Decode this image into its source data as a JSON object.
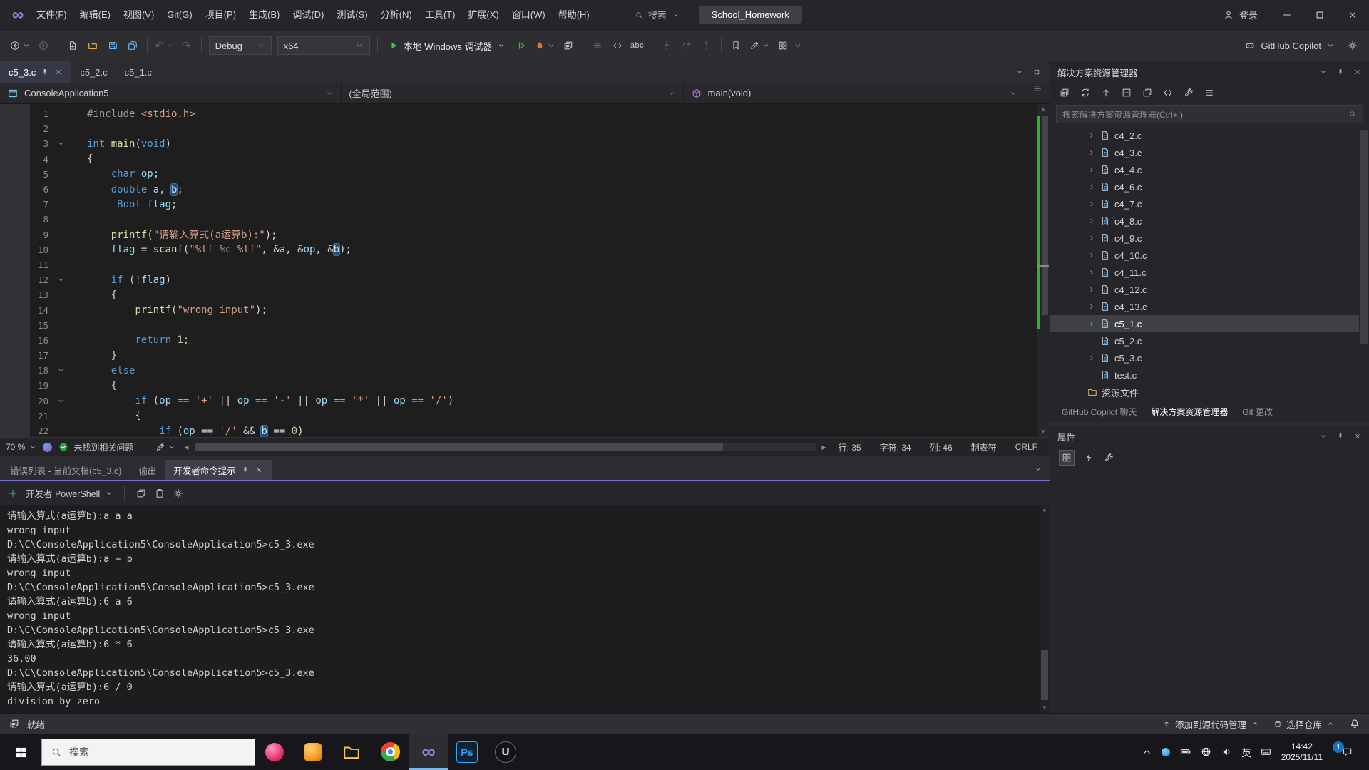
{
  "colors": {
    "accent_purple": "#7a73c9",
    "run_green": "#3fc34f",
    "change_bar_green": "#2db52d",
    "keyword_blue": "#569cd6",
    "string_orange": "#d69d85",
    "local_blue": "#9cdcfe",
    "function_yellow": "#dcdcaa",
    "number_green": "#b5cea8",
    "selection_blue": "#264f78",
    "editor_bg": "#1e1e1e"
  },
  "titlebar": {
    "menus": [
      "文件(F)",
      "编辑(E)",
      "视图(V)",
      "Git(G)",
      "项目(P)",
      "生成(B)",
      "调试(D)",
      "测试(S)",
      "分析(N)",
      "工具(T)",
      "扩展(X)",
      "窗口(W)",
      "帮助(H)"
    ],
    "search_label": "搜索",
    "solution_name": "School_Homework",
    "sign_in_label": "登录"
  },
  "toolbar": {
    "configuration": "Debug",
    "platform": "x64",
    "run_label": "本地 Windows 调试器",
    "spell_label": "abc",
    "copilot_label": "GitHub Copilot"
  },
  "editor": {
    "tabs": [
      {
        "label": "c5_3.c",
        "active": true
      },
      {
        "label": "c5_2.c"
      },
      {
        "label": "c5_1.c"
      }
    ],
    "navbar": {
      "project": "ConsoleApplication5",
      "scope": "(全局范围)",
      "member": "main(void)"
    },
    "code_lines": [
      {
        "n": 1,
        "tokens": [
          {
            "c": "pp",
            "t": "#include "
          },
          {
            "c": "str",
            "t": "<stdio.h>"
          }
        ]
      },
      {
        "n": 2,
        "tokens": []
      },
      {
        "n": 3,
        "fold": true,
        "tokens": [
          {
            "c": "kw",
            "t": "int"
          },
          {
            "c": "pl",
            "t": " "
          },
          {
            "c": "fn",
            "t": "main"
          },
          {
            "c": "pl",
            "t": "("
          },
          {
            "c": "kw",
            "t": "void"
          },
          {
            "c": "pl",
            "t": ")"
          }
        ]
      },
      {
        "n": 4,
        "tokens": [
          {
            "c": "pl",
            "t": "{"
          }
        ]
      },
      {
        "n": 5,
        "tokens": [
          {
            "c": "pl",
            "t": "    "
          },
          {
            "c": "kw",
            "t": "char"
          },
          {
            "c": "pl",
            "t": " "
          },
          {
            "c": "id",
            "t": "op"
          },
          {
            "c": "pl",
            "t": ";"
          }
        ]
      },
      {
        "n": 6,
        "tokens": [
          {
            "c": "pl",
            "t": "    "
          },
          {
            "c": "kw",
            "t": "double"
          },
          {
            "c": "pl",
            "t": " "
          },
          {
            "c": "id",
            "t": "a"
          },
          {
            "c": "pl",
            "t": ", "
          },
          {
            "c": "sel",
            "t": "b"
          },
          {
            "c": "pl",
            "t": ";"
          }
        ]
      },
      {
        "n": 7,
        "tokens": [
          {
            "c": "pl",
            "t": "    "
          },
          {
            "c": "kw",
            "t": "_Bool"
          },
          {
            "c": "pl",
            "t": " "
          },
          {
            "c": "id",
            "t": "flag"
          },
          {
            "c": "pl",
            "t": ";"
          }
        ]
      },
      {
        "n": 8,
        "tokens": []
      },
      {
        "n": 9,
        "tokens": [
          {
            "c": "pl",
            "t": "    "
          },
          {
            "c": "fn",
            "t": "printf"
          },
          {
            "c": "pl",
            "t": "("
          },
          {
            "c": "str",
            "t": "\"请输入算式(a运算b):\""
          },
          {
            "c": "pl",
            "t": ");"
          }
        ]
      },
      {
        "n": 10,
        "tokens": [
          {
            "c": "pl",
            "t": "    "
          },
          {
            "c": "id",
            "t": "flag"
          },
          {
            "c": "pl",
            "t": " = "
          },
          {
            "c": "fn",
            "t": "scanf"
          },
          {
            "c": "pl",
            "t": "("
          },
          {
            "c": "str",
            "t": "\"%lf %c %lf\""
          },
          {
            "c": "pl",
            "t": ", &"
          },
          {
            "c": "id",
            "t": "a"
          },
          {
            "c": "pl",
            "t": ", &"
          },
          {
            "c": "id",
            "t": "op"
          },
          {
            "c": "pl",
            "t": ", &"
          },
          {
            "c": "sel",
            "t": "b"
          },
          {
            "c": "pl",
            "t": ");"
          }
        ]
      },
      {
        "n": 11,
        "tokens": []
      },
      {
        "n": 12,
        "fold": true,
        "tokens": [
          {
            "c": "pl",
            "t": "    "
          },
          {
            "c": "kw",
            "t": "if"
          },
          {
            "c": "pl",
            "t": " (!"
          },
          {
            "c": "id",
            "t": "flag"
          },
          {
            "c": "pl",
            "t": ")"
          }
        ]
      },
      {
        "n": 13,
        "tokens": [
          {
            "c": "pl",
            "t": "    {"
          }
        ]
      },
      {
        "n": 14,
        "tokens": [
          {
            "c": "pl",
            "t": "        "
          },
          {
            "c": "fn",
            "t": "printf"
          },
          {
            "c": "pl",
            "t": "("
          },
          {
            "c": "str",
            "t": "\"wrong input\""
          },
          {
            "c": "pl",
            "t": ");"
          }
        ]
      },
      {
        "n": 15,
        "tokens": []
      },
      {
        "n": 16,
        "tokens": [
          {
            "c": "pl",
            "t": "        "
          },
          {
            "c": "kw",
            "t": "return"
          },
          {
            "c": "pl",
            "t": " "
          },
          {
            "c": "num",
            "t": "1"
          },
          {
            "c": "pl",
            "t": ";"
          }
        ]
      },
      {
        "n": 17,
        "tokens": [
          {
            "c": "pl",
            "t": "    }"
          }
        ]
      },
      {
        "n": 18,
        "fold": true,
        "tokens": [
          {
            "c": "pl",
            "t": "    "
          },
          {
            "c": "kw",
            "t": "else"
          }
        ]
      },
      {
        "n": 19,
        "tokens": [
          {
            "c": "pl",
            "t": "    {"
          }
        ]
      },
      {
        "n": 20,
        "fold": true,
        "tokens": [
          {
            "c": "pl",
            "t": "        "
          },
          {
            "c": "kw",
            "t": "if"
          },
          {
            "c": "pl",
            "t": " ("
          },
          {
            "c": "id",
            "t": "op"
          },
          {
            "c": "pl",
            "t": " == "
          },
          {
            "c": "str",
            "t": "'+'"
          },
          {
            "c": "pl",
            "t": " || "
          },
          {
            "c": "id",
            "t": "op"
          },
          {
            "c": "pl",
            "t": " == "
          },
          {
            "c": "str",
            "t": "'-'"
          },
          {
            "c": "pl",
            "t": " || "
          },
          {
            "c": "id",
            "t": "op"
          },
          {
            "c": "pl",
            "t": " == "
          },
          {
            "c": "str",
            "t": "'*'"
          },
          {
            "c": "pl",
            "t": " || "
          },
          {
            "c": "id",
            "t": "op"
          },
          {
            "c": "pl",
            "t": " == "
          },
          {
            "c": "str",
            "t": "'/'"
          },
          {
            "c": "pl",
            "t": ")"
          }
        ]
      },
      {
        "n": 21,
        "tokens": [
          {
            "c": "pl",
            "t": "        {"
          }
        ]
      },
      {
        "n": 22,
        "tokens": [
          {
            "c": "pl",
            "t": "            "
          },
          {
            "c": "kw",
            "t": "if"
          },
          {
            "c": "pl",
            "t": " ("
          },
          {
            "c": "id",
            "t": "op"
          },
          {
            "c": "pl",
            "t": " == "
          },
          {
            "c": "str",
            "t": "'/'"
          },
          {
            "c": "pl",
            "t": " && "
          },
          {
            "c": "sel",
            "t": "b"
          },
          {
            "c": "pl",
            "t": " == "
          },
          {
            "c": "num",
            "t": "0"
          },
          {
            "c": "pl",
            "t": ")"
          }
        ]
      }
    ],
    "status": {
      "zoom": "70 %",
      "health": "未找到相关问题",
      "line": "行: 35",
      "chars": "字符: 34",
      "col": "列: 46",
      "tabs_mode": "制表符",
      "eol": "CRLF"
    }
  },
  "bottom_panel": {
    "tabs": [
      {
        "label": "错误列表 - 当前文档(c5_3.c)"
      },
      {
        "label": "输出"
      },
      {
        "label": "开发者命令提示",
        "active": true
      }
    ],
    "shell_label": "开发者 PowerShell",
    "terminal_lines": [
      "请输入算式(a运算b):a a a",
      "wrong input",
      "D:\\C\\ConsoleApplication5\\ConsoleApplication5>c5_3.exe",
      "请输入算式(a运算b):a + b",
      "wrong input",
      "D:\\C\\ConsoleApplication5\\ConsoleApplication5>c5_3.exe",
      "请输入算式(a运算b):6 a 6",
      "wrong input",
      "D:\\C\\ConsoleApplication5\\ConsoleApplication5>c5_3.exe",
      "请输入算式(a运算b):6 * 6",
      "36.00",
      "D:\\C\\ConsoleApplication5\\ConsoleApplication5>c5_3.exe",
      "请输入算式(a运算b):6 / 0",
      "division by zero"
    ]
  },
  "solution_explorer": {
    "title": "解决方案资源管理器",
    "search_placeholder": "搜索解决方案资源管理器(Ctrl+;)",
    "items": [
      {
        "label": "c4_2.c",
        "arrow": true
      },
      {
        "label": "c4_3.c",
        "arrow": true
      },
      {
        "label": "c4_4.c",
        "arrow": true
      },
      {
        "label": "c4_6.c",
        "arrow": true
      },
      {
        "label": "c4_7.c",
        "arrow": true
      },
      {
        "label": "c4_8.c",
        "arrow": true
      },
      {
        "label": "c4_9.c",
        "arrow": true
      },
      {
        "label": "c4_10.c",
        "arrow": true
      },
      {
        "label": "c4_11.c",
        "arrow": true
      },
      {
        "label": "c4_12.c",
        "arrow": true
      },
      {
        "label": "c4_13.c",
        "arrow": true
      },
      {
        "label": "c5_1.c",
        "arrow": true,
        "selected": true
      },
      {
        "label": "c5_2.c"
      },
      {
        "label": "c5_3.c",
        "arrow": true
      },
      {
        "label": "test.c"
      },
      {
        "label": "资源文件",
        "folder": true
      }
    ],
    "bottom_tabs": [
      {
        "label": "GitHub Copilot 聊天"
      },
      {
        "label": "解决方案资源管理器",
        "active": true
      },
      {
        "label": "Git 更改"
      }
    ]
  },
  "properties": {
    "title": "属性"
  },
  "status_bar": {
    "ready": "就绪",
    "scm": "添加到源代码管理",
    "repo": "选择仓库"
  },
  "taskbar": {
    "search_placeholder": "搜索",
    "ps_label": "Ps",
    "u_label": "U",
    "ime_label": "英",
    "time": "14:42",
    "date": "2025/11/11",
    "notification_count": "1"
  }
}
